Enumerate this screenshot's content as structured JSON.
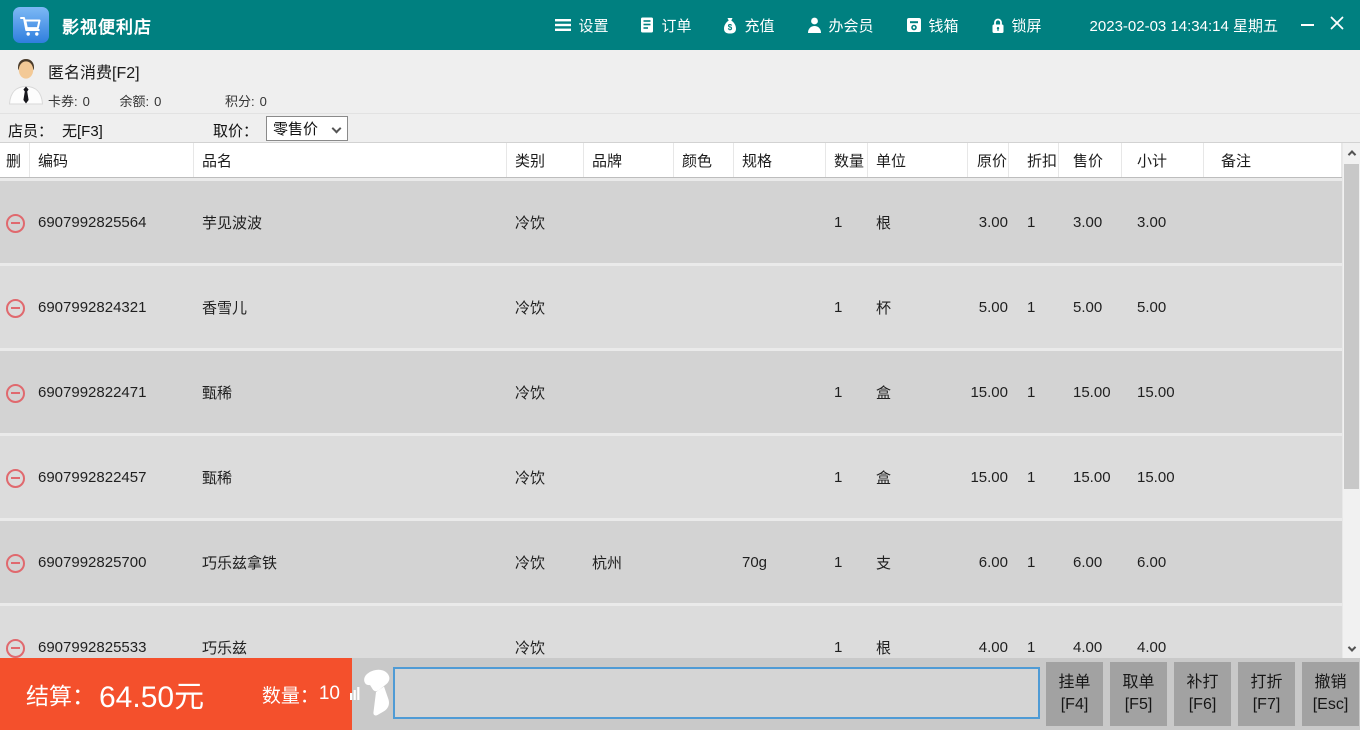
{
  "titlebar": {
    "app_title": "影视便利店",
    "menu": [
      {
        "icon": "hamburger-icon",
        "label": "设置"
      },
      {
        "icon": "receipt-icon",
        "label": "订单"
      },
      {
        "icon": "moneybag-icon",
        "label": "充值"
      },
      {
        "icon": "member-icon",
        "label": "办会员"
      },
      {
        "icon": "cashbox-icon",
        "label": "钱箱"
      },
      {
        "icon": "lock-icon",
        "label": "锁屏"
      }
    ],
    "datetime": "2023-02-03 14:34:14 星期五"
  },
  "customer": {
    "name": "匿名消费[F2]",
    "stats": [
      {
        "label": "卡券:",
        "value": "0"
      },
      {
        "label": "余额:",
        "value": "0"
      },
      {
        "label": "积分:",
        "value": "0"
      }
    ]
  },
  "clerk_bar": {
    "clerk_label": "店员：",
    "clerk_value": "无[F3]",
    "price_label": "取价：",
    "price_value": "零售价"
  },
  "table": {
    "columns": [
      "删",
      "编码",
      "品名",
      "类别",
      "品牌",
      "颜色",
      "规格",
      "数量",
      "单位",
      "原价",
      "折扣",
      "售价",
      "小计",
      "备注"
    ],
    "rows": [
      {
        "code": "6907992825564",
        "name": "芋见波波",
        "category": "冷饮",
        "brand": "",
        "color": "",
        "spec": "",
        "qty": "1",
        "unit": "根",
        "price": "3.00",
        "discount": "1",
        "sale": "3.00",
        "subtotal": "3.00",
        "note": ""
      },
      {
        "code": "6907992824321",
        "name": "香雪儿",
        "category": "冷饮",
        "brand": "",
        "color": "",
        "spec": "",
        "qty": "1",
        "unit": "杯",
        "price": "5.00",
        "discount": "1",
        "sale": "5.00",
        "subtotal": "5.00",
        "note": ""
      },
      {
        "code": "6907992822471",
        "name": "甄稀",
        "category": "冷饮",
        "brand": "",
        "color": "",
        "spec": "",
        "qty": "1",
        "unit": "盒",
        "price": "15.00",
        "discount": "1",
        "sale": "15.00",
        "subtotal": "15.00",
        "note": ""
      },
      {
        "code": "6907992822457",
        "name": "甄稀",
        "category": "冷饮",
        "brand": "",
        "color": "",
        "spec": "",
        "qty": "1",
        "unit": "盒",
        "price": "15.00",
        "discount": "1",
        "sale": "15.00",
        "subtotal": "15.00",
        "note": ""
      },
      {
        "code": "6907992825700",
        "name": "巧乐兹拿铁",
        "category": "冷饮",
        "brand": "杭州",
        "color": "",
        "spec": "70g",
        "qty": "1",
        "unit": "支",
        "price": "6.00",
        "discount": "1",
        "sale": "6.00",
        "subtotal": "6.00",
        "note": ""
      },
      {
        "code": "6907992825533",
        "name": "巧乐兹",
        "category": "冷饮",
        "brand": "",
        "color": "",
        "spec": "",
        "qty": "1",
        "unit": "根",
        "price": "4.00",
        "discount": "1",
        "sale": "4.00",
        "subtotal": "4.00",
        "note": ""
      }
    ]
  },
  "footer": {
    "total_label": "结算：",
    "total_value": "64.50元",
    "qty_label": "数量：",
    "qty_value": "10",
    "scan_input_value": "",
    "buttons": [
      {
        "label": "挂单",
        "key": "[F4]"
      },
      {
        "label": "取单",
        "key": "[F5]"
      },
      {
        "label": "补打",
        "key": "[F6]"
      },
      {
        "label": "打折",
        "key": "[F7]"
      },
      {
        "label": "撤销",
        "key": "[Esc]"
      }
    ]
  },
  "colors": {
    "titlebar_bg": "#008080",
    "footer_accent": "#f4502c",
    "row_odd": "#d3d3d3",
    "row_even": "#dcdcdc",
    "input_border": "#4f9bd5",
    "delete_icon": "#e0696e"
  }
}
